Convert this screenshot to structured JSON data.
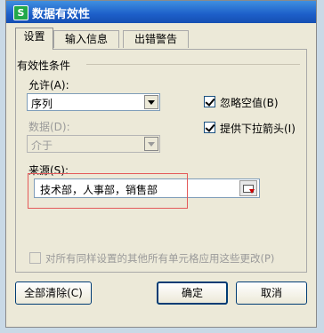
{
  "window": {
    "title": "数据有效性",
    "icon": "spreadsheet-app-icon"
  },
  "tabs": [
    {
      "label": "设置",
      "active": true
    },
    {
      "label": "输入信息",
      "active": false
    },
    {
      "label": "出错警告",
      "active": false
    }
  ],
  "criteria": {
    "group_title": "有效性条件",
    "allow_label": "允许(A):",
    "allow_value": "序列",
    "data_label": "数据(D):",
    "data_value": "介于",
    "ignore_blank_label": "忽略空值(B)",
    "ignore_blank_checked": true,
    "dropdown_label": "提供下拉箭头(I)",
    "dropdown_checked": true,
    "source_label": "来源(S):",
    "source_value": "技术部，人事部，销售部"
  },
  "apply_all_label": "对所有同样设置的其他所有单元格应用这些更改(P)",
  "buttons": {
    "clear_all": "全部清除(C)",
    "ok": "确定",
    "cancel": "取消"
  },
  "colors": {
    "highlight_box": "#e45a5a",
    "titlebar": "#1d5fc9"
  }
}
